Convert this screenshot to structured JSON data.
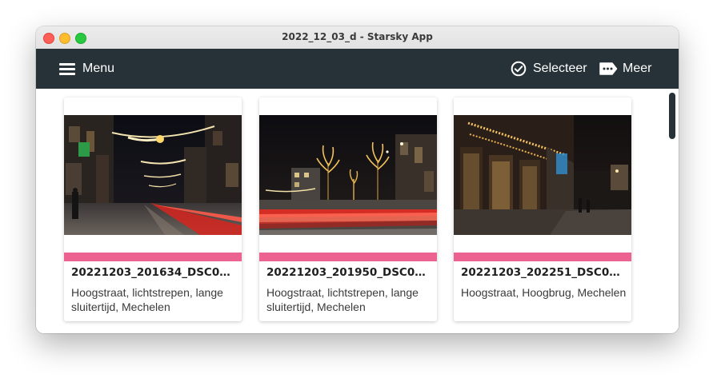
{
  "window": {
    "title": "2022_12_03_d - Starsky App"
  },
  "toolbar": {
    "menu_label": "Menu",
    "menu_icon": "hamburger-icon",
    "select_label": "Selecteer",
    "select_icon": "check-circle-icon",
    "more_label": "Meer",
    "more_icon": "more-tag-icon"
  },
  "colors": {
    "appbar": "#263238",
    "accent_bar": "#ec6392",
    "text": "#1f1f1f"
  },
  "cards": [
    {
      "title": "20221203_201634_DSC07...",
      "description": "Hoogstraat, lichtstrepen, lange sluitertijd, Mechelen"
    },
    {
      "title": "20221203_201950_DSC07...",
      "description": "Hoogstraat, lichtstrepen, lange sluitertijd, Mechelen"
    },
    {
      "title": "20221203_202251_DSC07...",
      "description": "Hoogstraat, Hoogbrug, Mechelen"
    }
  ]
}
